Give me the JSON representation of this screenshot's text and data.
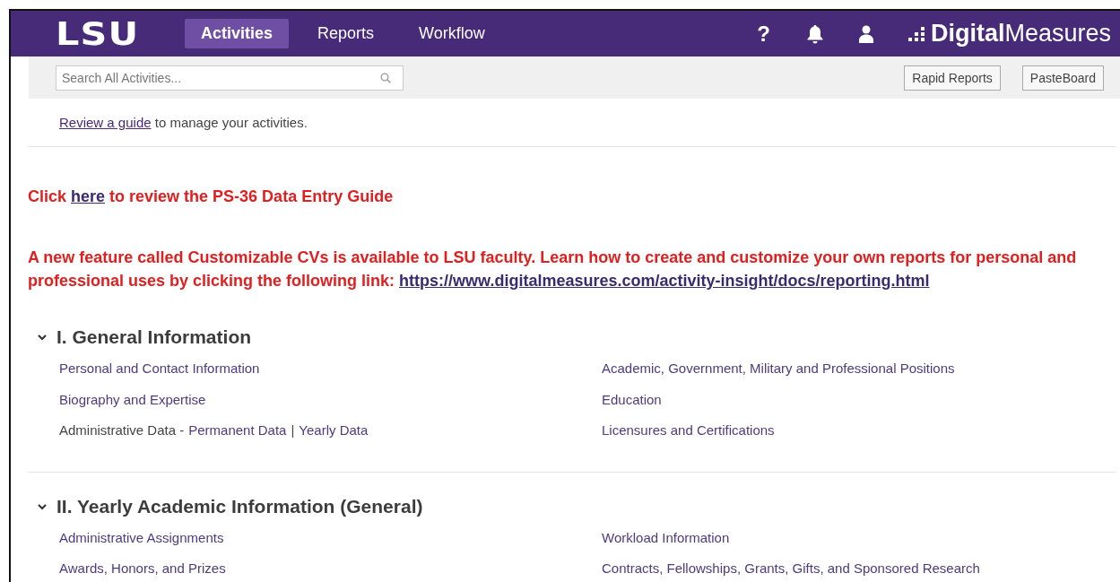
{
  "header": {
    "logo": "LSU",
    "tabs": [
      {
        "label": "Activities",
        "selected": true
      },
      {
        "label": "Reports",
        "selected": false
      },
      {
        "label": "Workflow",
        "selected": false
      }
    ],
    "help": "?",
    "brand": {
      "bold": "Digital",
      "light": "Measures"
    }
  },
  "toolbar": {
    "search": {
      "placeholder": "Search All Activities..."
    },
    "buttons": [
      "Rapid Reports",
      "PasteBoard"
    ]
  },
  "guide": {
    "link": "Review a guide",
    "text": " to manage your activities."
  },
  "notices": [
    {
      "parts": [
        {
          "text": "Click "
        },
        {
          "link": "here"
        },
        {
          "text": " to review the PS-36 Data Entry Guide"
        }
      ]
    },
    {
      "parts": [
        {
          "text": "A new feature called Customizable CVs is available to LSU faculty. Learn how to create and customize your own reports for personal and professional uses by clicking the following link: "
        },
        {
          "link": "https://www.digitalmeasures.com/activity-insight/docs/reporting.html"
        }
      ]
    }
  ],
  "sections": [
    {
      "title": "I. General Information",
      "expanded": true,
      "columns": [
        [
          {
            "kind": "link",
            "label": "Personal and Contact Information"
          },
          {
            "kind": "link",
            "label": "Biography and Expertise"
          },
          {
            "kind": "split",
            "label": "Administrative Data -",
            "links": [
              "Permanent Data",
              "Yearly Data"
            ],
            "separator": "|"
          }
        ],
        [
          {
            "kind": "link",
            "label": "Academic, Government, Military and Professional Positions"
          },
          {
            "kind": "link",
            "label": "Education"
          },
          {
            "kind": "link",
            "label": "Licensures and Certifications"
          }
        ]
      ]
    },
    {
      "title": "II. Yearly Academic Information (General)",
      "expanded": true,
      "columns": [
        [
          {
            "kind": "link",
            "label": "Administrative Assignments"
          },
          {
            "kind": "link",
            "label": "Awards, Honors, and Prizes"
          }
        ],
        [
          {
            "kind": "link",
            "label": "Workload Information"
          },
          {
            "kind": "link",
            "label": "Contracts, Fellowships, Grants, Gifts, and Sponsored Research"
          }
        ]
      ]
    }
  ]
}
